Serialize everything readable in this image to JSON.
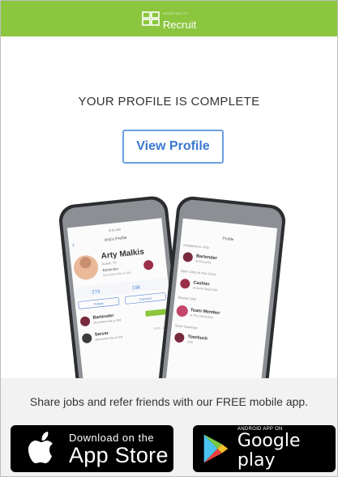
{
  "brand": {
    "name": "Recruit",
    "tagline": "HOSPITALITY",
    "color": "#8cc63f"
  },
  "headline": "YOUR PROFILE IS COMPLETE",
  "cta": {
    "label": "View Profile"
  },
  "mockup": {
    "left_phone": {
      "status_time": "9:41 AM",
      "screen_title": "Arty's Profile",
      "name": "Arty Malkis",
      "subtitle": "Austin, TX",
      "role": "Bartender",
      "venue": "Moonshine Bar & Grill",
      "stats": [
        "273",
        "196"
      ],
      "tabs": [
        "Follow",
        "Connect"
      ],
      "list": [
        {
          "title": "Bartender",
          "sub": "Moonshine Bar & Grill",
          "date": "2015"
        },
        {
          "title": "Server",
          "sub": "Moonshine Bar & Grill",
          "date": "2013 - 2015"
        }
      ]
    },
    "right_phone": {
      "screen_title": "Profile",
      "section_invites": "Invitations to: Arty",
      "items": [
        {
          "title": "Bartender",
          "sub": "at Pinocchio"
        },
        {
          "title": "Open Jobs at Your Store",
          "sub": ""
        },
        {
          "title": "Cashier",
          "sub": "at South Street Deli"
        },
        {
          "title": "Shared Jobs",
          "sub": ""
        },
        {
          "title": "Team Member",
          "sub": "at The Clementine"
        },
        {
          "title": "Store Openings",
          "sub": ""
        },
        {
          "title": "Toorbuck",
          "sub": "Cafe"
        }
      ]
    }
  },
  "share_text": "Share jobs and refer friends with our FREE mobile app.",
  "app_store": {
    "small": "Download on the",
    "big": "App Store",
    "icon": "apple-icon"
  },
  "google_play": {
    "small": "ANDROID APP ON",
    "big": "Google play",
    "icon": "google-play-icon"
  }
}
